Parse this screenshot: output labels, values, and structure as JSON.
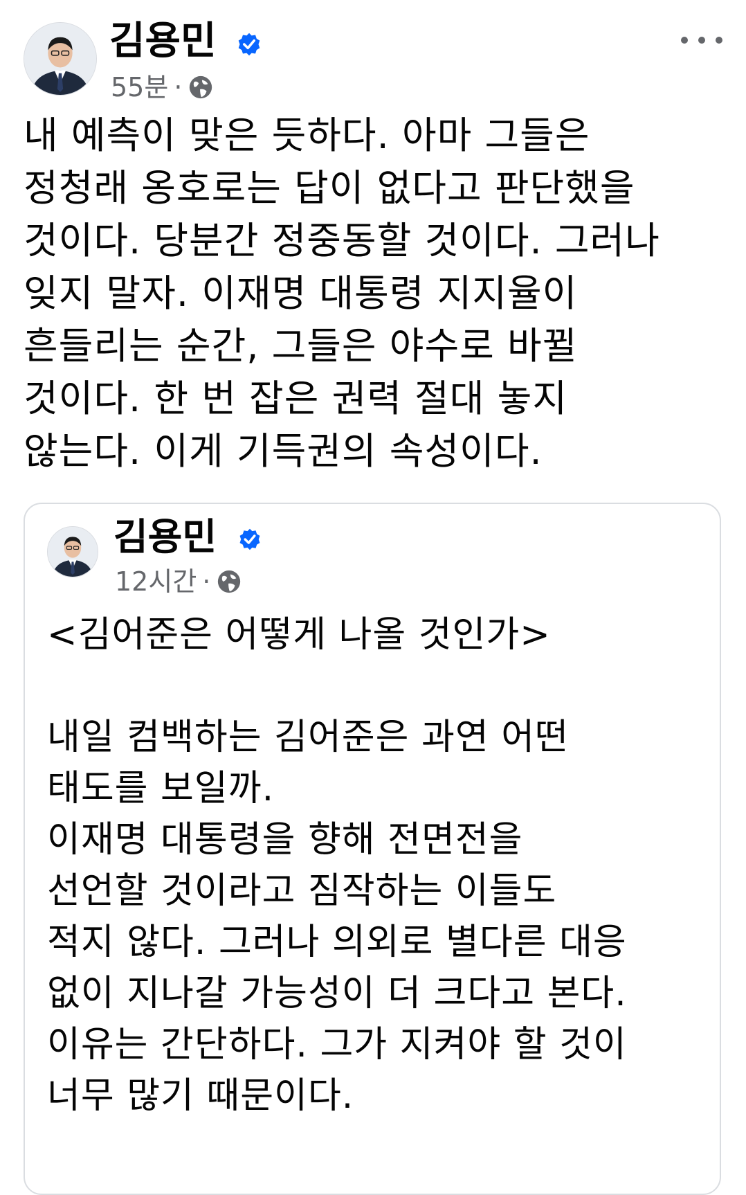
{
  "post": {
    "author": "김용민",
    "time": "55분",
    "separator": "·",
    "body": "내 예측이 맞은 듯하다. 아마 그들은\n정청래 옹호로는 답이 없다고 판단했을\n것이다. 당분간 정중동할 것이다. 그러나\n잊지 말자. 이재명 대통령 지지율이\n흔들리는 순간, 그들은 야수로 바뀔\n것이다. 한 번 잡은 권력 절대 놓지\n않는다. 이게 기득권의 속성이다."
  },
  "shared_post": {
    "author": "김용민",
    "time": "12시간",
    "separator": "·",
    "body": "<김어준은 어떻게 나올 것인가>\n\n내일 컴백하는 김어준은 과연 어떤\n태도를 보일까.\n이재명 대통령을 향해 전면전을\n선언할 것이라고 짐작하는 이들도\n적지 않다. 그러나 의외로 별다른 대응\n없이 지나갈 가능성이 더 크다고 본다.\n이유는 간단하다. 그가 지켜야 할 것이\n너무 많기 때문이다."
  },
  "icons": {
    "verified": "verified-badge-icon",
    "audience": "globe-icon",
    "more": "more-options-icon"
  },
  "colors": {
    "verified_blue": "#0866ff",
    "meta_gray": "#65676b",
    "text": "#050505",
    "card_border": "#dadde1"
  }
}
